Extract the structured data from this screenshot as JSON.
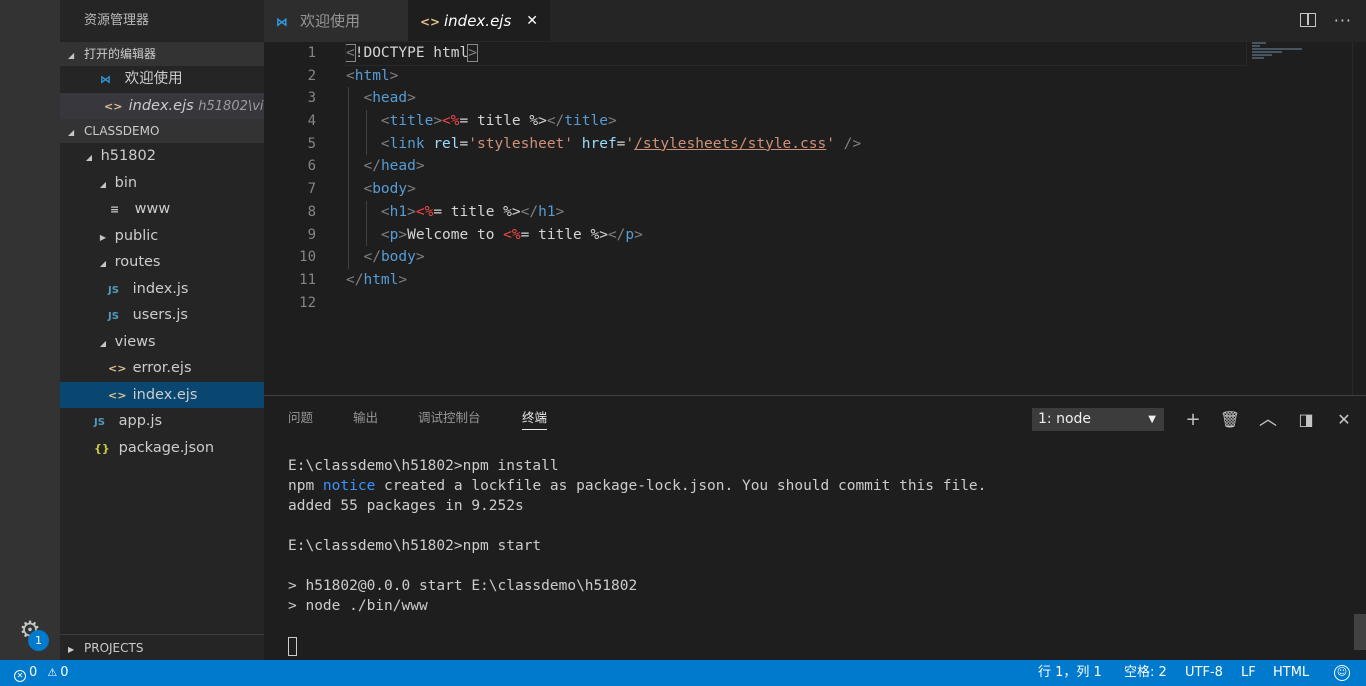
{
  "sidebar": {
    "title": "资源管理器",
    "open_editors_label": "打开的编辑器",
    "open_editors": [
      {
        "icon": "vscode-icon",
        "label": "欢迎使用",
        "path": ""
      },
      {
        "icon": "ejs-file-icon",
        "label": "index.ejs",
        "path": "h51802\\vi..."
      }
    ],
    "folder_label": "CLASSDEMO",
    "tree": [
      {
        "label": "h51802",
        "icon": "",
        "tri": "down"
      },
      {
        "label": "bin",
        "icon": "",
        "tri": "down"
      },
      {
        "label": "www",
        "icon": "file-lines-icon",
        "tri": ""
      },
      {
        "label": "public",
        "icon": "",
        "tri": "right"
      },
      {
        "label": "routes",
        "icon": "",
        "tri": "down"
      },
      {
        "label": "index.js",
        "icon": "js-file-icon",
        "tri": ""
      },
      {
        "label": "users.js",
        "icon": "js-file-icon",
        "tri": ""
      },
      {
        "label": "views",
        "icon": "",
        "tri": "down"
      },
      {
        "label": "error.ejs",
        "icon": "ejs-file-icon",
        "tri": ""
      },
      {
        "label": "index.ejs",
        "icon": "ejs-file-icon",
        "tri": ""
      },
      {
        "label": "app.js",
        "icon": "js-file-icon",
        "tri": ""
      },
      {
        "label": "package.json",
        "icon": "json-file-icon",
        "tri": ""
      }
    ],
    "projects_label": "PROJECTS",
    "settings_badge": "1"
  },
  "tabs": [
    {
      "label": "欢迎使用",
      "icon": "vscode-icon",
      "active": false
    },
    {
      "label": "index.ejs",
      "icon": "ejs-file-icon",
      "active": true
    }
  ],
  "editor": {
    "line_numbers": [
      "1",
      "2",
      "3",
      "4",
      "5",
      "6",
      "7",
      "8",
      "9",
      "10",
      "11",
      "12"
    ],
    "code": {
      "l1_a": "<",
      "l1_b": "!DOCTYPE html",
      "l1_c": ">",
      "l2_tag": "html",
      "l3_tag": "head",
      "l4_open": "title",
      "l4_ejs_open": "<%",
      "l4_expr": "= title ",
      "l4_ejs_close": "%>",
      "l4_close": "title",
      "l5_tag": "link",
      "l5_attr1": "rel",
      "l5_val1": "'stylesheet'",
      "l5_attr2": "href",
      "l5_q1": "'",
      "l5_url": "/stylesheets/style.css",
      "l5_q2": "'",
      "l5_end": " />",
      "l6_tag": "head",
      "l7_tag": "body",
      "l8_open": "h1",
      "l8_ejs_open": "<%",
      "l8_expr": "= title ",
      "l8_ejs_close": "%>",
      "l8_close": "h1",
      "l9_open": "p",
      "l9_text": "Welcome to ",
      "l9_ejs_open": "<%",
      "l9_expr": "= title ",
      "l9_ejs_close": "%>",
      "l9_close": "p",
      "l10_tag": "body",
      "l11_tag": "html"
    }
  },
  "panel": {
    "tabs": [
      "问题",
      "输出",
      "调试控制台",
      "终端"
    ],
    "active_tab": "终端",
    "terminal_select": "1: node",
    "terminal_lines": {
      "l1": "E:\\classdemo\\h51802>npm install",
      "l2_a": "npm ",
      "l2_notice": "notice",
      "l2_b": " created a lockfile as package-lock.json. You should commit this file.",
      "l3": "added 55 packages in 9.252s",
      "l5": "E:\\classdemo\\h51802>npm start",
      "l7": "> h51802@0.0.0 start E:\\classdemo\\h51802",
      "l8": "> node ./bin/www"
    }
  },
  "status": {
    "errors": "0",
    "warnings": "0",
    "position": "行 1，列 1",
    "spaces": "空格: 2",
    "encoding": "UTF-8",
    "eol": "LF",
    "language": "HTML"
  },
  "colors": {
    "accent": "#007acc",
    "selection": "#094771"
  }
}
